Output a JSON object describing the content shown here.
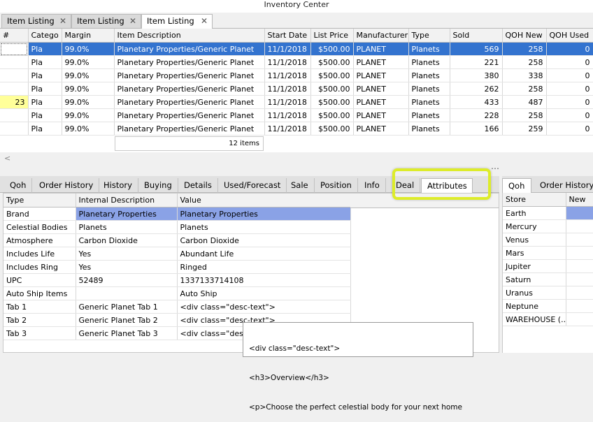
{
  "window": {
    "title": "Inventory Center"
  },
  "doc_tabs": [
    {
      "label": "Item Listing",
      "close": "✕"
    },
    {
      "label": "Item Listing",
      "close": "✕"
    },
    {
      "label": "Item Listing",
      "close": "✕"
    }
  ],
  "items": {
    "columns": [
      "#",
      "Catego",
      "Margin",
      "Item Description",
      "Start Date",
      "List Price",
      "Manufacturer",
      "Type",
      "Sold",
      "QOH New",
      "QOH Used"
    ],
    "rows": [
      [
        "",
        "Pla",
        "99.0%",
        "Planetary Properties/Generic Planet",
        "11/1/2018",
        "$500.00",
        "PLANET",
        "Planets",
        "569",
        "258",
        "0"
      ],
      [
        "",
        "Pla",
        "99.0%",
        "Planetary Properties/Generic Planet",
        "11/1/2018",
        "$500.00",
        "PLANET",
        "Planets",
        "221",
        "258",
        "0"
      ],
      [
        "",
        "Pla",
        "99.0%",
        "Planetary Properties/Generic Planet",
        "11/1/2018",
        "$500.00",
        "PLANET",
        "Planets",
        "380",
        "338",
        "0"
      ],
      [
        "",
        "Pla",
        "99.0%",
        "Planetary Properties/Generic Planet",
        "11/1/2018",
        "$500.00",
        "PLANET",
        "Planets",
        "262",
        "258",
        "0"
      ],
      [
        "23",
        "Pla",
        "99.0%",
        "Planetary Properties/Generic Planet",
        "11/1/2018",
        "$500.00",
        "PLANET",
        "Planets",
        "433",
        "487",
        "0"
      ],
      [
        "",
        "Pla",
        "99.0%",
        "Planetary Properties/Generic Planet",
        "11/1/2018",
        "$500.00",
        "PLANET",
        "Planets",
        "228",
        "258",
        "0"
      ],
      [
        "",
        "Pla",
        "99.0%",
        "Planetary Properties/Generic Planet",
        "11/1/2018",
        "$500.00",
        "PLANET",
        "Planets",
        "166",
        "259",
        "0"
      ]
    ],
    "count": "12 items",
    "scroll_left": "<",
    "splitter_grip": "⋯"
  },
  "detail_tabs": [
    "Qoh",
    "Order History",
    "History",
    "Buying",
    "Details",
    "Used/Forecast",
    "Sale",
    "Position",
    "Info",
    "Deal",
    "Attributes"
  ],
  "attributes": {
    "columns": [
      "Type",
      "Internal Description",
      "Value"
    ],
    "rows": [
      [
        "Brand",
        "Planetary Properties",
        "Planetary Properties"
      ],
      [
        "Celestial Bodies",
        "Planets",
        "Planets"
      ],
      [
        "Atmosphere",
        "Carbon Dioxide",
        "Carbon Dioxide"
      ],
      [
        "Includes Life",
        "Yes",
        "Abundant Life"
      ],
      [
        "Includes Ring",
        "Yes",
        "Ringed"
      ],
      [
        "UPC",
        "52489",
        "1337133714108"
      ],
      [
        "Auto Ship Items",
        "",
        "Auto Ship"
      ],
      [
        "Tab 1",
        "Generic Planet Tab 1",
        "<div class=\"desc-text\">"
      ],
      [
        "Tab 2",
        "Generic Planet Tab 2",
        "<div class=\"desc-text\">"
      ],
      [
        "Tab 3",
        "Generic Planet Tab 3",
        "<div class=\"desc-"
      ]
    ]
  },
  "tooltip": {
    "lines": [
      "<div class=\"desc-text\">",
      "<h3>Overview</h3>",
      "<p>Choose the perfect celestial body for your next home"
    ]
  },
  "right_tabs": [
    "Qoh",
    "Order History"
  ],
  "stores": {
    "columns": [
      "Store",
      "New"
    ],
    "rows": [
      "Earth",
      "Mercury",
      "Venus",
      "Mars",
      "Jupiter",
      "Saturn",
      "Uranus",
      "Neptune",
      "WAREHOUSE (..."
    ]
  },
  "colors": {
    "selection": "#3373cf",
    "callout": "#ddec2a",
    "row_marker": "#ffff99"
  }
}
